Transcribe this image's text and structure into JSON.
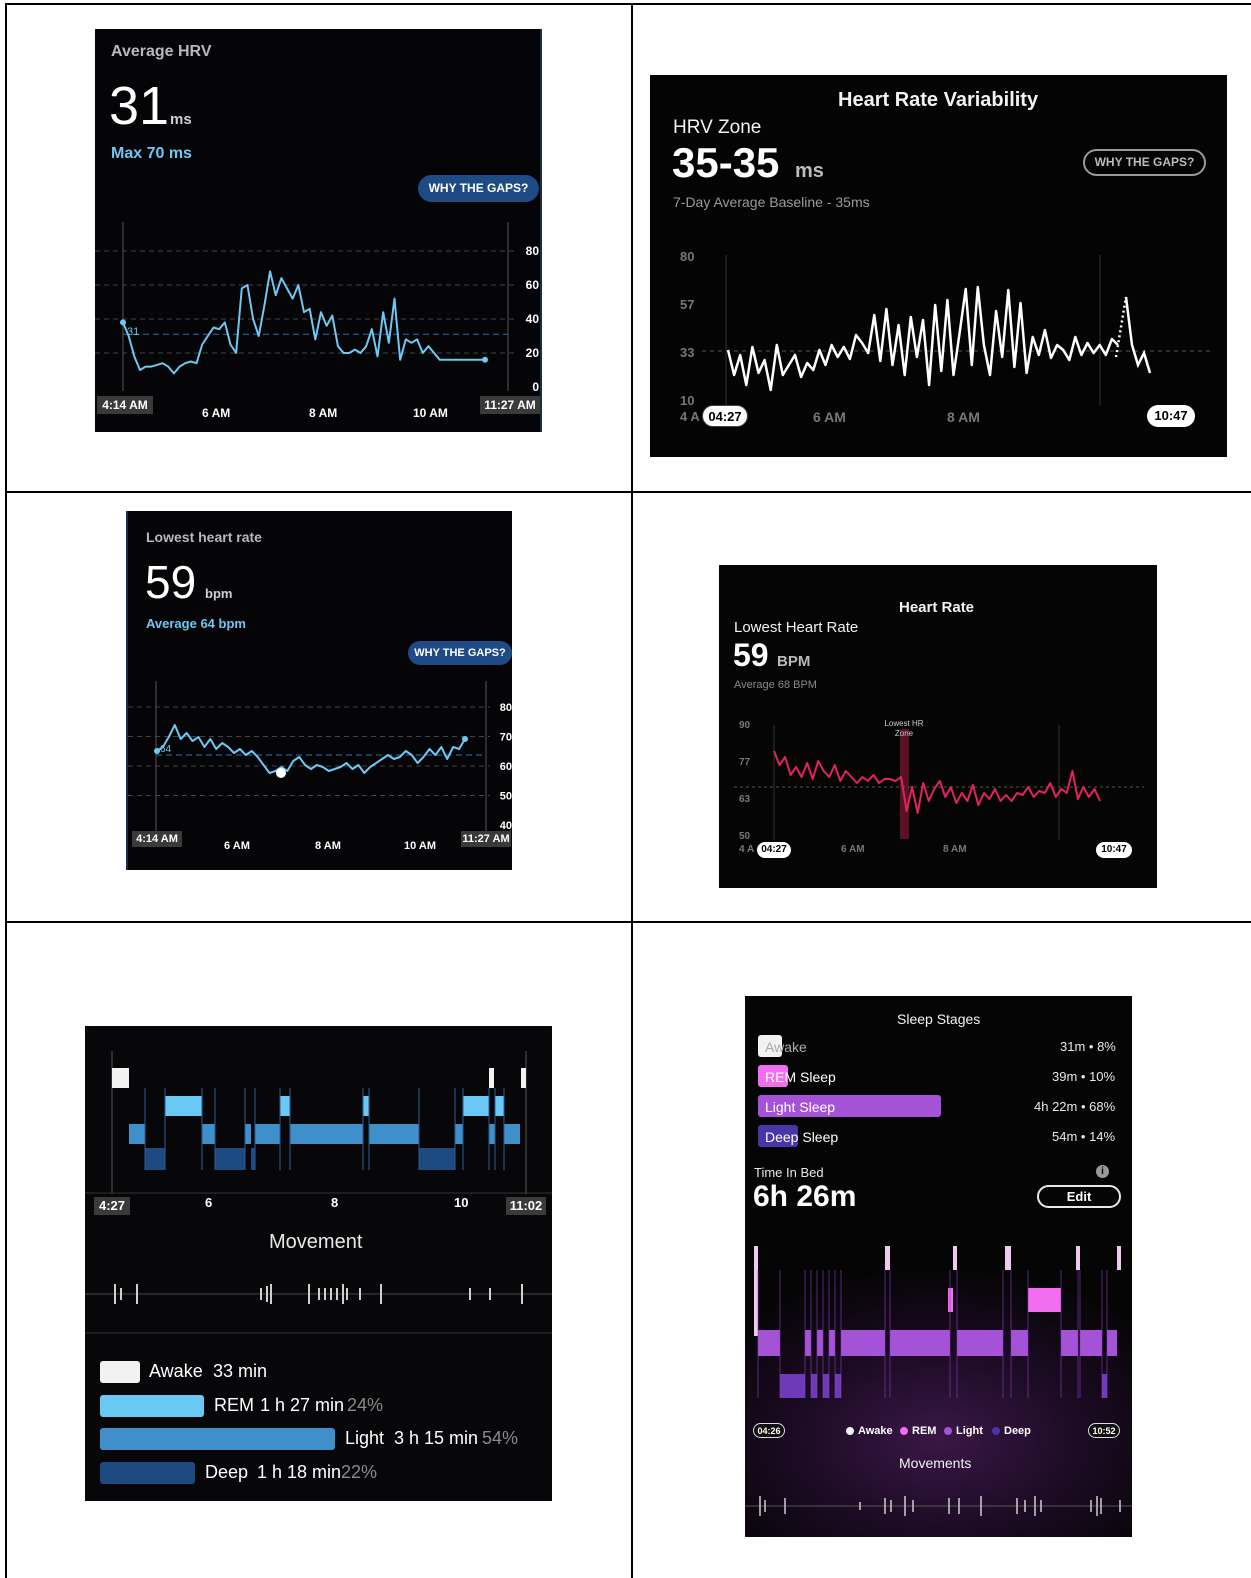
{
  "colors": {
    "oura_blue": "#6fc7f2",
    "pill_blue": "#1e4b85",
    "hr_red": "#e0245e",
    "awake": "#f2f2f2",
    "rem_blue": "#6ac8f5",
    "light_blue": "#3f8fcb",
    "deep_blue": "#1d4a80",
    "pink": "#f26df0",
    "purple": "#a452d6",
    "deep_purple": "#4a35a8"
  },
  "hrv_oura": {
    "title": "Average HRV",
    "value": "31",
    "unit": "ms",
    "max_label": "Max 70 ms",
    "gaps_button": "WHY THE GAPS?",
    "point_label": "31",
    "x_start": "4:14 AM",
    "x_ticks": [
      "6 AM",
      "8 AM",
      "10 AM"
    ],
    "x_end": "11:27 AM",
    "chart_data": {
      "type": "line",
      "y_ticks": [
        "80",
        "60",
        "40",
        "20",
        "0"
      ],
      "ylim": [
        0,
        80
      ],
      "x": [
        0,
        2,
        4,
        6,
        8,
        10,
        12,
        14,
        16,
        18,
        20,
        22,
        24,
        26,
        28,
        30,
        32,
        34,
        36,
        38,
        40,
        42,
        44,
        46,
        48,
        50,
        52,
        54,
        56,
        58,
        60,
        62,
        64,
        66,
        68,
        70,
        72,
        74,
        76,
        78,
        80,
        82,
        84,
        86,
        88,
        90,
        92,
        94,
        96,
        98,
        100,
        102,
        104,
        106,
        108,
        110,
        112,
        114,
        116,
        118,
        120,
        122,
        124,
        126,
        128
      ],
      "values": [
        38,
        30,
        18,
        10,
        12,
        12,
        13,
        14,
        12,
        8,
        12,
        14,
        15,
        14,
        25,
        30,
        35,
        34,
        38,
        25,
        20,
        58,
        60,
        40,
        30,
        48,
        68,
        54,
        64,
        58,
        52,
        60,
        44,
        46,
        28,
        44,
        36,
        42,
        24,
        20,
        20,
        22,
        20,
        24,
        34,
        18,
        44,
        26,
        52,
        16,
        28,
        26,
        28,
        20,
        24,
        20,
        16,
        16,
        16,
        16,
        16,
        16,
        16,
        16,
        16
      ],
      "series_note": ""
    }
  },
  "hrv_whoop": {
    "header": "Heart Rate Variability",
    "label": "HRV Zone",
    "value": "35-35",
    "unit": "ms",
    "baseline": "7-Day Average Baseline - 35ms",
    "gaps_button": "WHY THE GAPS?",
    "y_ticks": [
      "80",
      "57",
      "33",
      "10"
    ],
    "x_prefix": "4 A",
    "x_start": "04:27",
    "x_ticks": [
      "6 AM",
      "8 AM"
    ],
    "x_end": "10:47"
  },
  "hr_oura": {
    "title": "Lowest heart rate",
    "value": "59",
    "unit": "bpm",
    "avg_label": "Average 64 bpm",
    "gaps_button": "WHY THE GAPS?",
    "point_label": "64",
    "x_start": "4:14 AM",
    "x_ticks": [
      "6 AM",
      "8 AM",
      "10 AM"
    ],
    "x_end": "11:27 AM",
    "y_ticks": [
      "80",
      "70",
      "60",
      "50",
      "40"
    ]
  },
  "hr_whoop": {
    "header": "Heart Rate",
    "label": "Lowest Heart Rate",
    "value": "59",
    "unit": "BPM",
    "avg_label": "Average 68 BPM",
    "zone_label": "Lowest HR Zone",
    "y_ticks": [
      "90",
      "77",
      "63",
      "50"
    ],
    "x_prefix": "4 A",
    "x_start": "04:27",
    "x_ticks": [
      "6 AM",
      "8 AM"
    ],
    "x_end": "10:47"
  },
  "sleep_oura": {
    "x_start": "4:27",
    "x_ticks": [
      "6",
      "8",
      "10"
    ],
    "x_end": "11:02",
    "movement_title": "Movement",
    "legend": [
      {
        "label": "Awake",
        "duration": "33 min",
        "pct": ""
      },
      {
        "label": "REM",
        "duration": "1 h 27 min",
        "pct": "24%"
      },
      {
        "label": "Light",
        "duration": "3 h 15 min",
        "pct": "54%"
      },
      {
        "label": "Deep",
        "duration": "1 h 18 min",
        "pct": "22%"
      }
    ]
  },
  "sleep_whoop": {
    "header": "Sleep Stages",
    "stages": [
      {
        "label": "Awake",
        "value": "31m • 8%"
      },
      {
        "label": "REM Sleep",
        "value": "39m • 10%"
      },
      {
        "label": "Light Sleep",
        "value": "4h 22m • 68%"
      },
      {
        "label": "Deep Sleep",
        "value": "54m • 14%"
      }
    ],
    "time_in_bed_label": "Time In Bed",
    "time_in_bed_value": "6h 26m",
    "info_icon": "info-icon",
    "edit_button": "Edit",
    "x_start": "04:26",
    "x_end": "10:52",
    "legend": [
      "Awake",
      "REM",
      "Light",
      "Deep"
    ],
    "movements_title": "Movements"
  }
}
